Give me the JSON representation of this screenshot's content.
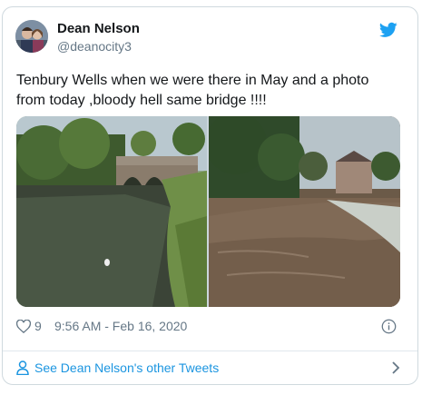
{
  "tweet": {
    "author_name": "Dean Nelson",
    "author_handle": "@deanocity3",
    "text": "Tenbury Wells when we were there in May and a photo from today ,bloody hell same bridge !!!!",
    "like_count": "9",
    "timestamp": "9:56 AM - Feb 16, 2020"
  },
  "footer": {
    "link_label": "See Dean Nelson's other Tweets"
  },
  "icons": {
    "brand": "twitter-bird-icon",
    "like": "heart-icon",
    "info": "info-icon",
    "profile": "person-icon",
    "chevron": "chevron-right-icon"
  },
  "colors": {
    "twitter_blue": "#1da1f2",
    "link_blue": "#1b95e0",
    "muted_text": "#657786",
    "border": "#cfd9de"
  }
}
